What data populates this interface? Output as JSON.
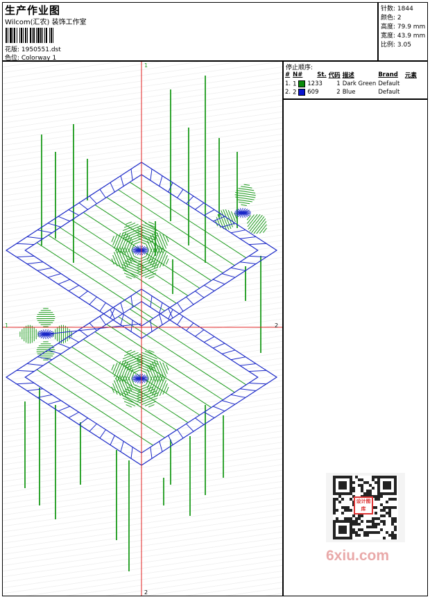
{
  "header": {
    "title": "生产作业图",
    "company": "Wilcom(汇农) 装饰工作室",
    "design_label": "花版: 1950551.dst",
    "colorway_label": "色位: Colorway 1"
  },
  "stats": {
    "stitches": "针数: 1844",
    "colors": "颜色: 2",
    "height": "高度: 79.9 mm",
    "width": "宽度: 43.9 mm",
    "scale": "比例: 3.05"
  },
  "stop_sequence": {
    "heading": "停止顺序:",
    "columns": [
      "#",
      "N#",
      "St.",
      "代码",
      "描述",
      "Brand",
      "元素"
    ],
    "rows": [
      {
        "idx": "1.",
        "needle": "1",
        "color": "#0a8a0a",
        "stitches": "1233",
        "code": "1",
        "description": "Dark Green",
        "brand": "Default"
      },
      {
        "idx": "2.",
        "needle": "2",
        "color": "#0a14d0",
        "stitches": "609",
        "code": "2",
        "description": "Blue",
        "brand": "Default"
      }
    ]
  },
  "axes": {
    "top": "1",
    "bottom": "2",
    "left": "1",
    "right": "2"
  },
  "colors": {
    "green": "#1a9a1a",
    "blue": "#1a28c8",
    "axis": "#e02020"
  },
  "watermark": {
    "badge": "设计图库",
    "text": "6xiu.com"
  }
}
